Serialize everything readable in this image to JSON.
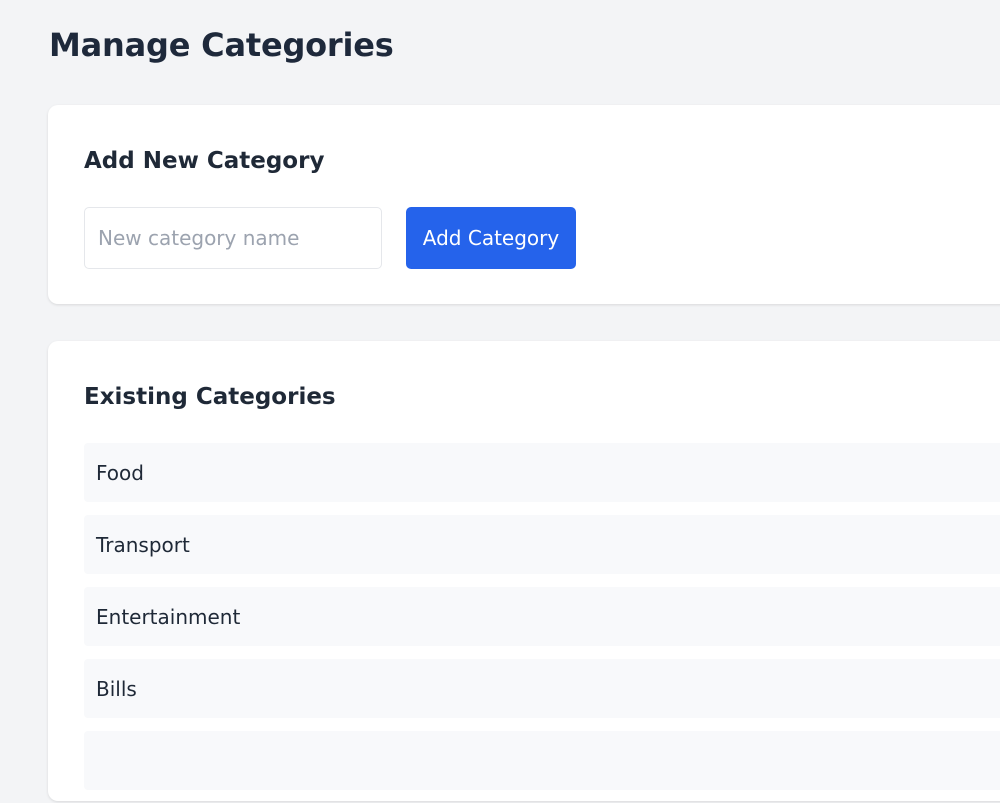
{
  "page": {
    "title": "Manage Categories"
  },
  "add_card": {
    "heading": "Add New Category",
    "input_placeholder": "New category name",
    "input_value": "",
    "button_label": "Add Category"
  },
  "list_card": {
    "heading": "Existing Categories",
    "items": [
      {
        "label": "Food"
      },
      {
        "label": "Transport"
      },
      {
        "label": "Entertainment"
      },
      {
        "label": "Bills"
      },
      {
        "label": ""
      }
    ]
  },
  "colors": {
    "accent": "#2563eb",
    "background": "#f3f4f6",
    "card": "#ffffff",
    "list_item": "#f8f9fb"
  }
}
